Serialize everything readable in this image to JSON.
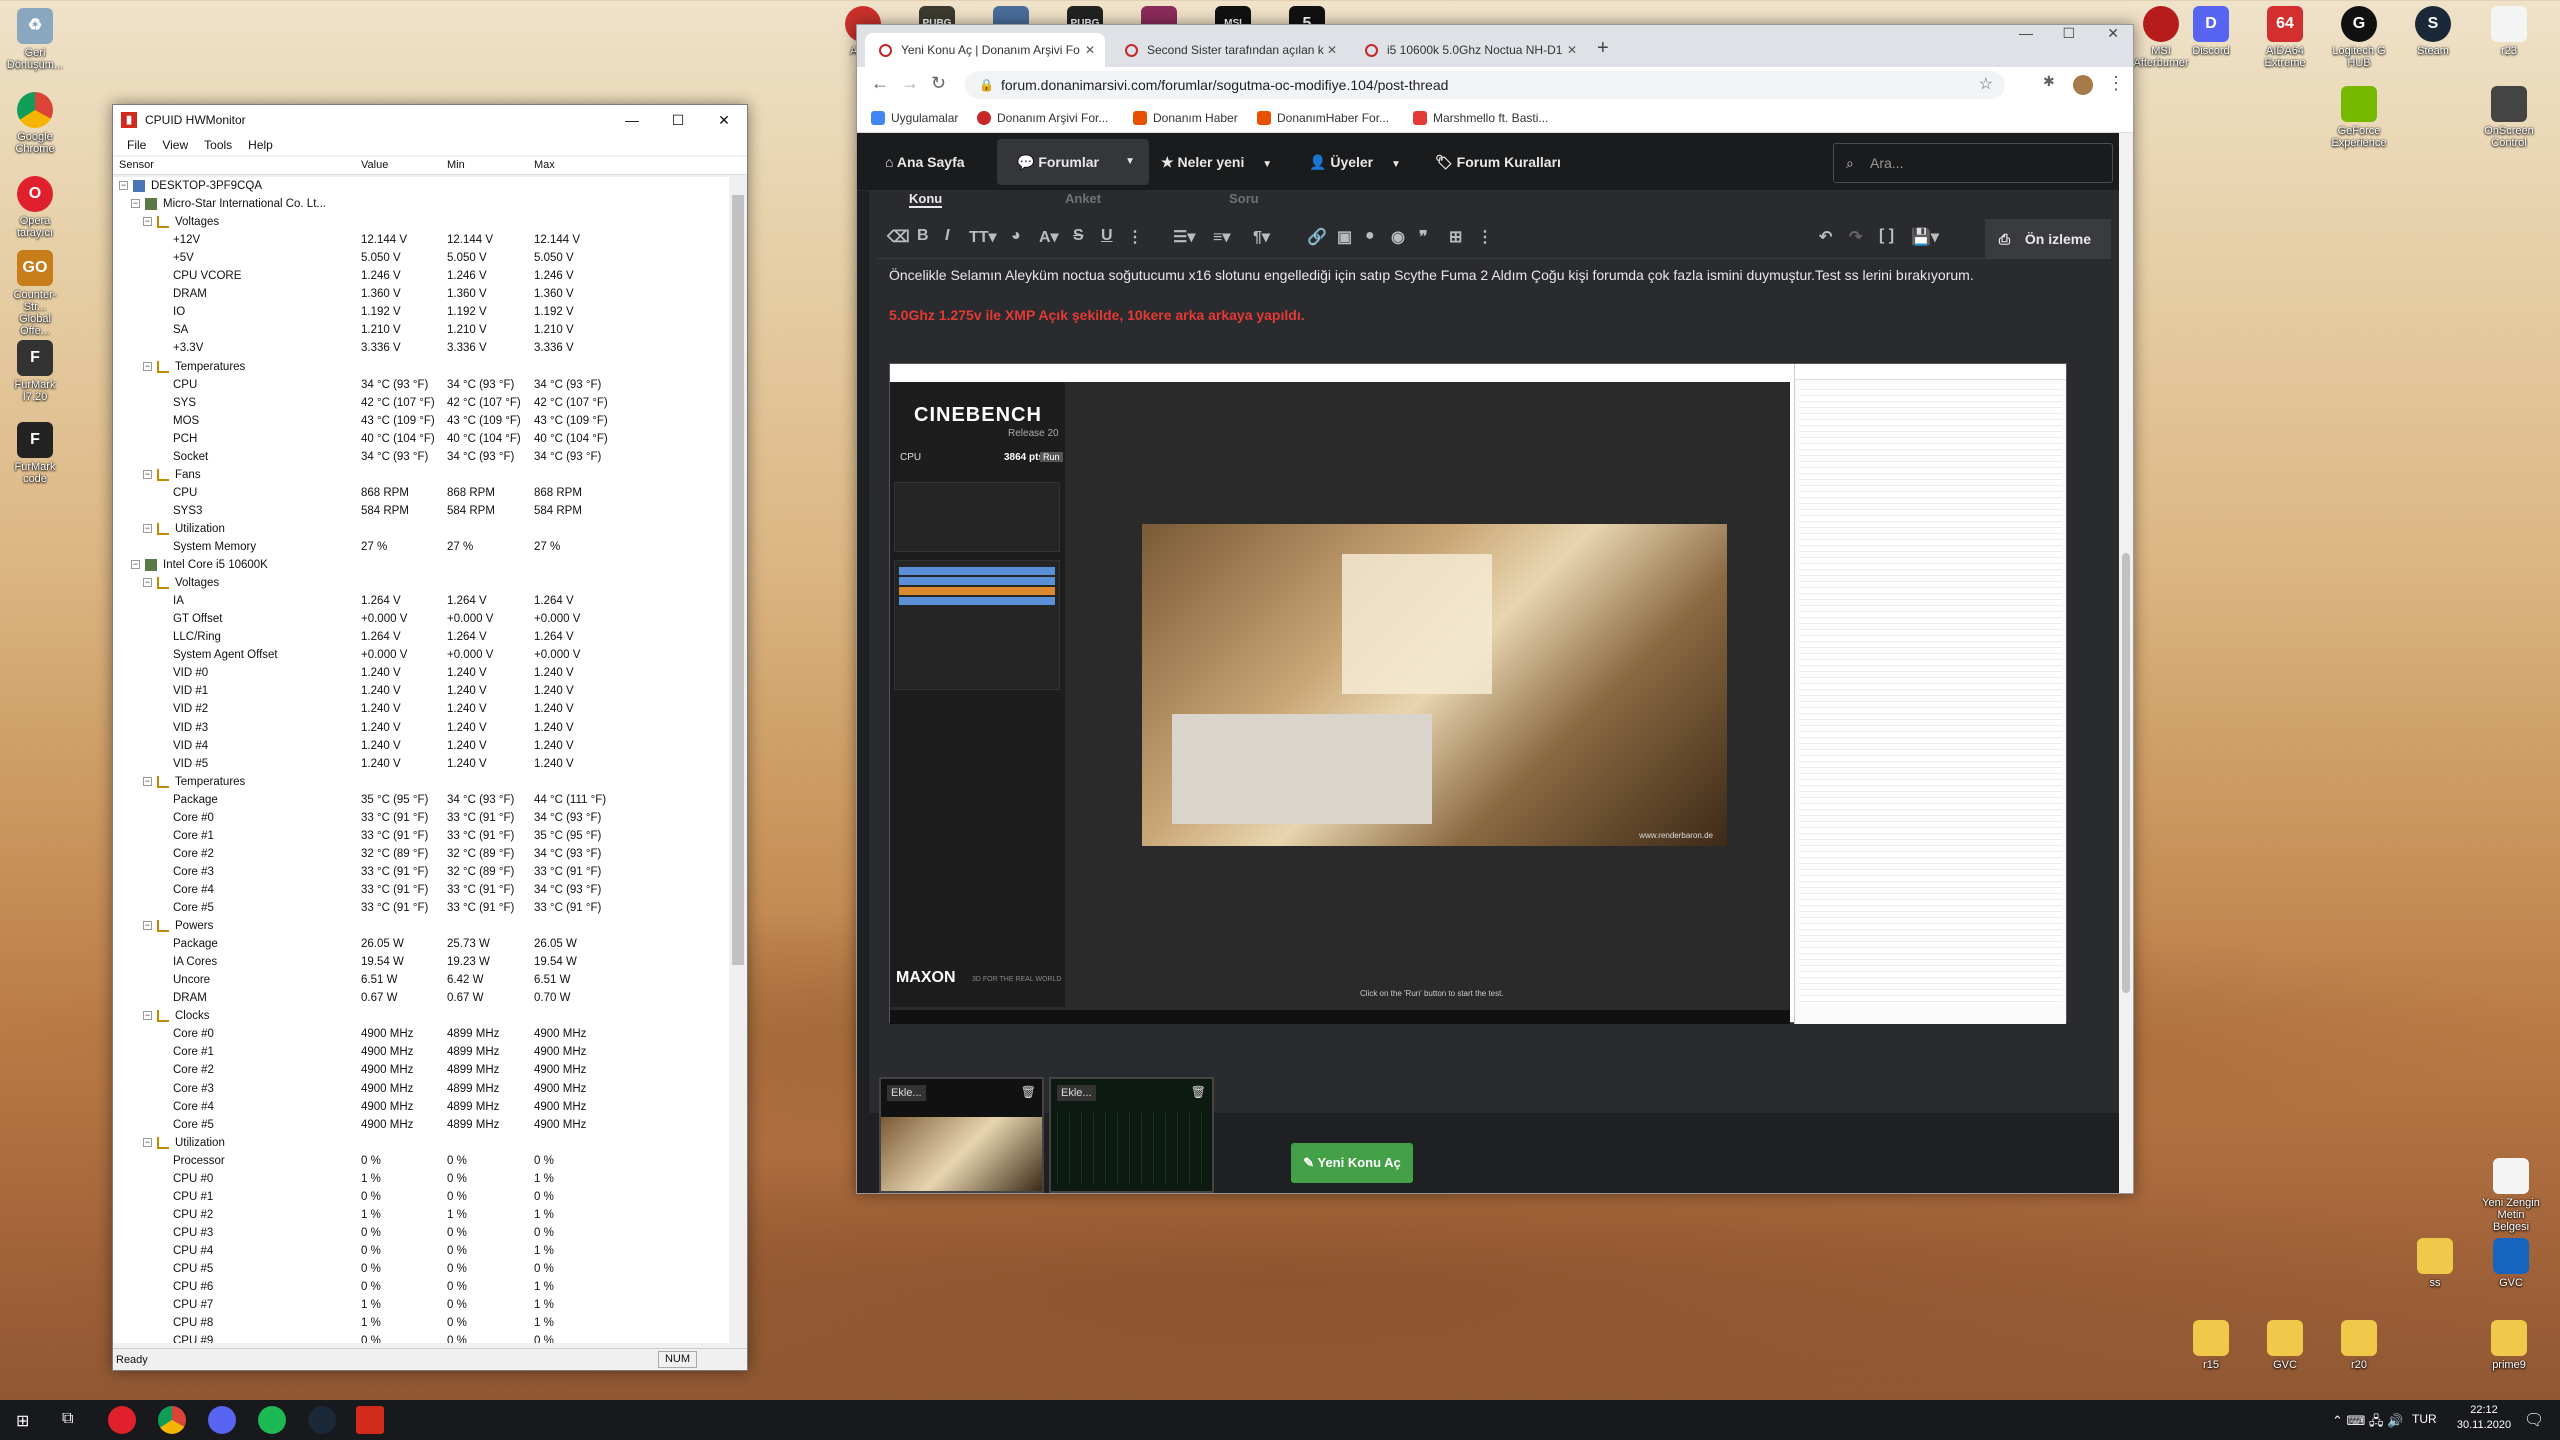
{
  "desktop": {
    "left_icons": [
      "Geri\nDönüşüm...",
      "Google\nChrome",
      "Opera\ntarayıcı",
      "Counter-Str...\nGlobal Offe...",
      "FurMark\nİ7.20",
      "FurMark\ncode"
    ],
    "top_icons": [
      "Am...",
      "PUBG",
      "",
      "PUBG",
      "",
      "MSI",
      "5"
    ],
    "right_icons": [
      "MSI\nAfterburner",
      "Discord",
      "AIDA64\nExtreme",
      "Logitech G\nHUB",
      "Steam",
      "r23",
      "GeForce\nExperience",
      "OnScreen\nControl"
    ],
    "bottom_icons": [
      "Yeni Zengin\nMetin Belgesi",
      "ss",
      "GVC",
      "r15",
      "GVC",
      "r20",
      "prime9"
    ]
  },
  "hwm": {
    "title": "CPUID HWMonitor",
    "menu": [
      "File",
      "View",
      "Tools",
      "Help"
    ],
    "columns": [
      "Sensor",
      "Value",
      "Min",
      "Max"
    ],
    "status": "Ready",
    "num": "NUM",
    "rows": [
      {
        "d": 0,
        "t": "n",
        "l": "DESKTOP-3PF9CQA"
      },
      {
        "d": 1,
        "t": "n",
        "l": "Micro-Star International Co. Lt..."
      },
      {
        "d": 2,
        "t": "g",
        "l": "Voltages"
      },
      {
        "d": 3,
        "l": "+12V",
        "v": "12.144 V",
        "mn": "12.144 V",
        "mx": "12.144 V"
      },
      {
        "d": 3,
        "l": "+5V",
        "v": "5.050 V",
        "mn": "5.050 V",
        "mx": "5.050 V"
      },
      {
        "d": 3,
        "l": "CPU VCORE",
        "v": "1.246 V",
        "mn": "1.246 V",
        "mx": "1.246 V"
      },
      {
        "d": 3,
        "l": "DRAM",
        "v": "1.360 V",
        "mn": "1.360 V",
        "mx": "1.360 V"
      },
      {
        "d": 3,
        "l": "IO",
        "v": "1.192 V",
        "mn": "1.192 V",
        "mx": "1.192 V"
      },
      {
        "d": 3,
        "l": "SA",
        "v": "1.210 V",
        "mn": "1.210 V",
        "mx": "1.210 V"
      },
      {
        "d": 3,
        "l": "+3.3V",
        "v": "3.336 V",
        "mn": "3.336 V",
        "mx": "3.336 V"
      },
      {
        "d": 2,
        "t": "g",
        "l": "Temperatures"
      },
      {
        "d": 3,
        "l": "CPU",
        "v": "34 °C  (93 °F)",
        "mn": "34 °C  (93 °F)",
        "mx": "34 °C  (93 °F)"
      },
      {
        "d": 3,
        "l": "SYS",
        "v": "42 °C  (107 °F)",
        "mn": "42 °C  (107 °F)",
        "mx": "42 °C  (107 °F)"
      },
      {
        "d": 3,
        "l": "MOS",
        "v": "43 °C  (109 °F)",
        "mn": "43 °C  (109 °F)",
        "mx": "43 °C  (109 °F)"
      },
      {
        "d": 3,
        "l": "PCH",
        "v": "40 °C  (104 °F)",
        "mn": "40 °C  (104 °F)",
        "mx": "40 °C  (104 °F)"
      },
      {
        "d": 3,
        "l": "Socket",
        "v": "34 °C  (93 °F)",
        "mn": "34 °C  (93 °F)",
        "mx": "34 °C  (93 °F)"
      },
      {
        "d": 2,
        "t": "g",
        "l": "Fans"
      },
      {
        "d": 3,
        "l": "CPU",
        "v": "868 RPM",
        "mn": "868 RPM",
        "mx": "868 RPM"
      },
      {
        "d": 3,
        "l": "SYS3",
        "v": "584 RPM",
        "mn": "584 RPM",
        "mx": "584 RPM"
      },
      {
        "d": 2,
        "t": "g",
        "l": "Utilization"
      },
      {
        "d": 3,
        "l": "System Memory",
        "v": "27 %",
        "mn": "27 %",
        "mx": "27 %"
      },
      {
        "d": 1,
        "t": "n",
        "l": "Intel Core i5 10600K"
      },
      {
        "d": 2,
        "t": "g",
        "l": "Voltages"
      },
      {
        "d": 3,
        "l": "IA",
        "v": "1.264 V",
        "mn": "1.264 V",
        "mx": "1.264 V"
      },
      {
        "d": 3,
        "l": "GT Offset",
        "v": "+0.000 V",
        "mn": "+0.000 V",
        "mx": "+0.000 V"
      },
      {
        "d": 3,
        "l": "LLC/Ring",
        "v": "1.264 V",
        "mn": "1.264 V",
        "mx": "1.264 V"
      },
      {
        "d": 3,
        "l": "System Agent Offset",
        "v": "+0.000 V",
        "mn": "+0.000 V",
        "mx": "+0.000 V"
      },
      {
        "d": 3,
        "l": "VID #0",
        "v": "1.240 V",
        "mn": "1.240 V",
        "mx": "1.240 V"
      },
      {
        "d": 3,
        "l": "VID #1",
        "v": "1.240 V",
        "mn": "1.240 V",
        "mx": "1.240 V"
      },
      {
        "d": 3,
        "l": "VID #2",
        "v": "1.240 V",
        "mn": "1.240 V",
        "mx": "1.240 V"
      },
      {
        "d": 3,
        "l": "VID #3",
        "v": "1.240 V",
        "mn": "1.240 V",
        "mx": "1.240 V"
      },
      {
        "d": 3,
        "l": "VID #4",
        "v": "1.240 V",
        "mn": "1.240 V",
        "mx": "1.240 V"
      },
      {
        "d": 3,
        "l": "VID #5",
        "v": "1.240 V",
        "mn": "1.240 V",
        "mx": "1.240 V"
      },
      {
        "d": 2,
        "t": "g",
        "l": "Temperatures"
      },
      {
        "d": 3,
        "l": "Package",
        "v": "35 °C  (95 °F)",
        "mn": "34 °C  (93 °F)",
        "mx": "44 °C  (111 °F)"
      },
      {
        "d": 3,
        "l": "Core #0",
        "v": "33 °C  (91 °F)",
        "mn": "33 °C  (91 °F)",
        "mx": "34 °C  (93 °F)"
      },
      {
        "d": 3,
        "l": "Core #1",
        "v": "33 °C  (91 °F)",
        "mn": "33 °C  (91 °F)",
        "mx": "35 °C  (95 °F)"
      },
      {
        "d": 3,
        "l": "Core #2",
        "v": "32 °C  (89 °F)",
        "mn": "32 °C  (89 °F)",
        "mx": "34 °C  (93 °F)"
      },
      {
        "d": 3,
        "l": "Core #3",
        "v": "33 °C  (91 °F)",
        "mn": "32 °C  (89 °F)",
        "mx": "33 °C  (91 °F)"
      },
      {
        "d": 3,
        "l": "Core #4",
        "v": "33 °C  (91 °F)",
        "mn": "33 °C  (91 °F)",
        "mx": "34 °C  (93 °F)"
      },
      {
        "d": 3,
        "l": "Core #5",
        "v": "33 °C  (91 °F)",
        "mn": "33 °C  (91 °F)",
        "mx": "33 °C  (91 °F)"
      },
      {
        "d": 2,
        "t": "g",
        "l": "Powers"
      },
      {
        "d": 3,
        "l": "Package",
        "v": "26.05 W",
        "mn": "25.73 W",
        "mx": "26.05 W"
      },
      {
        "d": 3,
        "l": "IA Cores",
        "v": "19.54 W",
        "mn": "19.23 W",
        "mx": "19.54 W"
      },
      {
        "d": 3,
        "l": "Uncore",
        "v": "6.51 W",
        "mn": "6.42 W",
        "mx": "6.51 W"
      },
      {
        "d": 3,
        "l": "DRAM",
        "v": "0.67 W",
        "mn": "0.67 W",
        "mx": "0.70 W"
      },
      {
        "d": 2,
        "t": "g",
        "l": "Clocks"
      },
      {
        "d": 3,
        "l": "Core #0",
        "v": "4900 MHz",
        "mn": "4899 MHz",
        "mx": "4900 MHz"
      },
      {
        "d": 3,
        "l": "Core #1",
        "v": "4900 MHz",
        "mn": "4899 MHz",
        "mx": "4900 MHz"
      },
      {
        "d": 3,
        "l": "Core #2",
        "v": "4900 MHz",
        "mn": "4899 MHz",
        "mx": "4900 MHz"
      },
      {
        "d": 3,
        "l": "Core #3",
        "v": "4900 MHz",
        "mn": "4899 MHz",
        "mx": "4900 MHz"
      },
      {
        "d": 3,
        "l": "Core #4",
        "v": "4900 MHz",
        "mn": "4899 MHz",
        "mx": "4900 MHz"
      },
      {
        "d": 3,
        "l": "Core #5",
        "v": "4900 MHz",
        "mn": "4899 MHz",
        "mx": "4900 MHz"
      },
      {
        "d": 2,
        "t": "g",
        "l": "Utilization"
      },
      {
        "d": 3,
        "l": "Processor",
        "v": "0 %",
        "mn": "0 %",
        "mx": "0 %"
      },
      {
        "d": 3,
        "l": "CPU #0",
        "v": "1 %",
        "mn": "0 %",
        "mx": "1 %"
      },
      {
        "d": 3,
        "l": "CPU #1",
        "v": "0 %",
        "mn": "0 %",
        "mx": "0 %"
      },
      {
        "d": 3,
        "l": "CPU #2",
        "v": "1 %",
        "mn": "1 %",
        "mx": "1 %"
      },
      {
        "d": 3,
        "l": "CPU #3",
        "v": "0 %",
        "mn": "0 %",
        "mx": "0 %"
      },
      {
        "d": 3,
        "l": "CPU #4",
        "v": "0 %",
        "mn": "0 %",
        "mx": "1 %"
      },
      {
        "d": 3,
        "l": "CPU #5",
        "v": "0 %",
        "mn": "0 %",
        "mx": "0 %"
      },
      {
        "d": 3,
        "l": "CPU #6",
        "v": "0 %",
        "mn": "0 %",
        "mx": "1 %"
      },
      {
        "d": 3,
        "l": "CPU #7",
        "v": "1 %",
        "mn": "0 %",
        "mx": "1 %"
      },
      {
        "d": 3,
        "l": "CPU #8",
        "v": "1 %",
        "mn": "0 %",
        "mx": "1 %"
      },
      {
        "d": 3,
        "l": "CPU #9",
        "v": "0 %",
        "mn": "0 %",
        "mx": "0 %"
      }
    ]
  },
  "browser": {
    "tabs": [
      "Yeni Konu Aç | Donanım Arşivi Fo",
      "Second Sister tarafından açılan k",
      "i5 10600k 5.0Ghz Noctua NH-D1"
    ],
    "url": "forum.donanimarsivi.com/forumlar/sogutma-oc-modifiye.104/post-thread",
    "bookmarks": [
      "Uygulamalar",
      "Donanım Arşivi For...",
      "Donanım Haber",
      "DonanımHaber For...",
      "Marshmello ft. Basti..."
    ],
    "nav": [
      "Ana Sayfa",
      "Forumlar",
      "Neler yeni",
      "Üyeler",
      "Forum Kuralları"
    ],
    "search_placeholder": "Ara...",
    "subtabs": [
      "Konu",
      "Anket",
      "Soru"
    ],
    "preview": "Ön izleme",
    "post_text": "Öncelikle Selamın Aleyküm noctua soğutucumu x16 slotunu engellediği için satıp Scythe Fuma 2 Aldım Çoğu kişi forumda çok fazla ismini duymuştur.Test ss lerini bırakıyorum.",
    "post_red": "5.0Ghz 1.275v ile XMP Açık şekilde, 10kere arka arkaya yapıldı.",
    "attach_labels": [
      "Ekle...",
      "Ekle..."
    ],
    "submit": "Yeni Konu Aç",
    "cinebench": {
      "brand": "CINEBENCH",
      "release": "Release 20",
      "cpu": "CPU",
      "score": "3864 pts",
      "run": "Run",
      "maxon": "MAXON",
      "tagline": "3D FOR THE REAL WORLD",
      "watermark": "www.renderbaron.de",
      "hint": "Click on the 'Run' button to start the test."
    }
  },
  "taskbar": {
    "lang": "TUR",
    "time": "22:12",
    "date": "30.11.2020"
  }
}
